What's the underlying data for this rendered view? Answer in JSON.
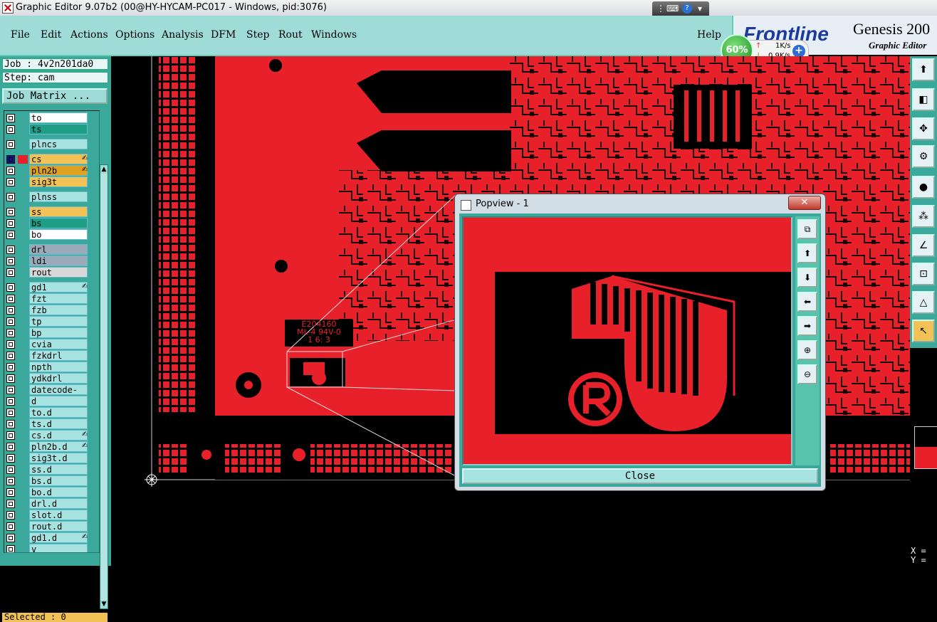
{
  "window": {
    "title": "Graphic Editor 9.07b2 (00@HY-HYCAM-PC017 - Windows, pid:3076)"
  },
  "menu": [
    "File",
    "Edit",
    "Actions",
    "Options",
    "Analysis",
    "DFM",
    "Step",
    "Rout",
    "Windows"
  ],
  "help_label": "Help",
  "brand": {
    "logo": "Frontline",
    "product": "Genesis 200",
    "subtitle": "Graphic Editor"
  },
  "net_monitor": {
    "percent": "60%",
    "up": "1K/s",
    "down": "0.9K/s"
  },
  "job": {
    "job_label": "Job : 4v2n201da0",
    "step_label": "Step: cam",
    "matrix_button": "Job Matrix ..."
  },
  "layers": [
    {
      "name": "to",
      "color": "#ffffff",
      "swatch": ""
    },
    {
      "name": "ts",
      "color": "#1f9e86",
      "swatch": ""
    },
    {
      "name": "plncs",
      "color": "#a6e3e1",
      "swatch": ""
    },
    {
      "name": "cs",
      "color": "#f3c256",
      "swatch": "#e8202a",
      "selected": true,
      "lock": "✍"
    },
    {
      "name": "pln2b",
      "color": "#e0a020",
      "swatch": "",
      "lock": "✍"
    },
    {
      "name": "sig3t",
      "color": "#f3c256",
      "swatch": ""
    },
    {
      "name": "plnss",
      "color": "#a6e3e1",
      "swatch": ""
    },
    {
      "name": "ss",
      "color": "#f3c256",
      "swatch": ""
    },
    {
      "name": "bs",
      "color": "#1f9e86",
      "swatch": ""
    },
    {
      "name": "bo",
      "color": "#ffffff",
      "swatch": ""
    },
    {
      "name": "drl",
      "color": "#9aaab8",
      "swatch": ""
    },
    {
      "name": "ldi",
      "color": "#9aaab8",
      "swatch": ""
    },
    {
      "name": "rout",
      "color": "#d8d8d8",
      "swatch": ""
    },
    {
      "name": "gd1",
      "color": "#a6e3e1",
      "swatch": "",
      "lock": "✍"
    },
    {
      "name": "fzt",
      "color": "#a6e3e1",
      "swatch": ""
    },
    {
      "name": "fzb",
      "color": "#a6e3e1",
      "swatch": ""
    },
    {
      "name": "tp",
      "color": "#a6e3e1",
      "swatch": ""
    },
    {
      "name": "bp",
      "color": "#a6e3e1",
      "swatch": ""
    },
    {
      "name": "cvia",
      "color": "#a6e3e1",
      "swatch": ""
    },
    {
      "name": "fzkdrl",
      "color": "#a6e3e1",
      "swatch": ""
    },
    {
      "name": "npth",
      "color": "#a6e3e1",
      "swatch": ""
    },
    {
      "name": "ydkdrl",
      "color": "#a6e3e1",
      "swatch": ""
    },
    {
      "name": "datecode-cs",
      "color": "#a6e3e1",
      "swatch": ""
    },
    {
      "name": "d",
      "color": "#a6e3e1",
      "swatch": ""
    },
    {
      "name": "to.d",
      "color": "#a6e3e1",
      "swatch": ""
    },
    {
      "name": "ts.d",
      "color": "#a6e3e1",
      "swatch": ""
    },
    {
      "name": "cs.d",
      "color": "#a6e3e1",
      "swatch": "",
      "lock": "✍"
    },
    {
      "name": "pln2b.d",
      "color": "#a6e3e1",
      "swatch": "",
      "lock": "✍"
    },
    {
      "name": "sig3t.d",
      "color": "#a6e3e1",
      "swatch": ""
    },
    {
      "name": "ss.d",
      "color": "#a6e3e1",
      "swatch": ""
    },
    {
      "name": "bs.d",
      "color": "#a6e3e1",
      "swatch": ""
    },
    {
      "name": "bo.d",
      "color": "#a6e3e1",
      "swatch": ""
    },
    {
      "name": "drl.d",
      "color": "#a6e3e1",
      "swatch": ""
    },
    {
      "name": "slot.d",
      "color": "#a6e3e1",
      "swatch": ""
    },
    {
      "name": "rout.d",
      "color": "#a6e3e1",
      "swatch": ""
    },
    {
      "name": "gd1.d",
      "color": "#a6e3e1",
      "swatch": "",
      "lock": "✍"
    },
    {
      "name": "v",
      "color": "#a6e3e1",
      "swatch": ""
    }
  ],
  "status": {
    "selected": "Selected : 0",
    "x_label": "X =",
    "y_label": "Y ="
  },
  "board": {
    "marking": [
      "E204160",
      "ML-4 94V-0",
      "1 6: 3"
    ],
    "copper_color": "#e8202a"
  },
  "popview": {
    "title": "Popview - 1",
    "close_label": "Close"
  }
}
